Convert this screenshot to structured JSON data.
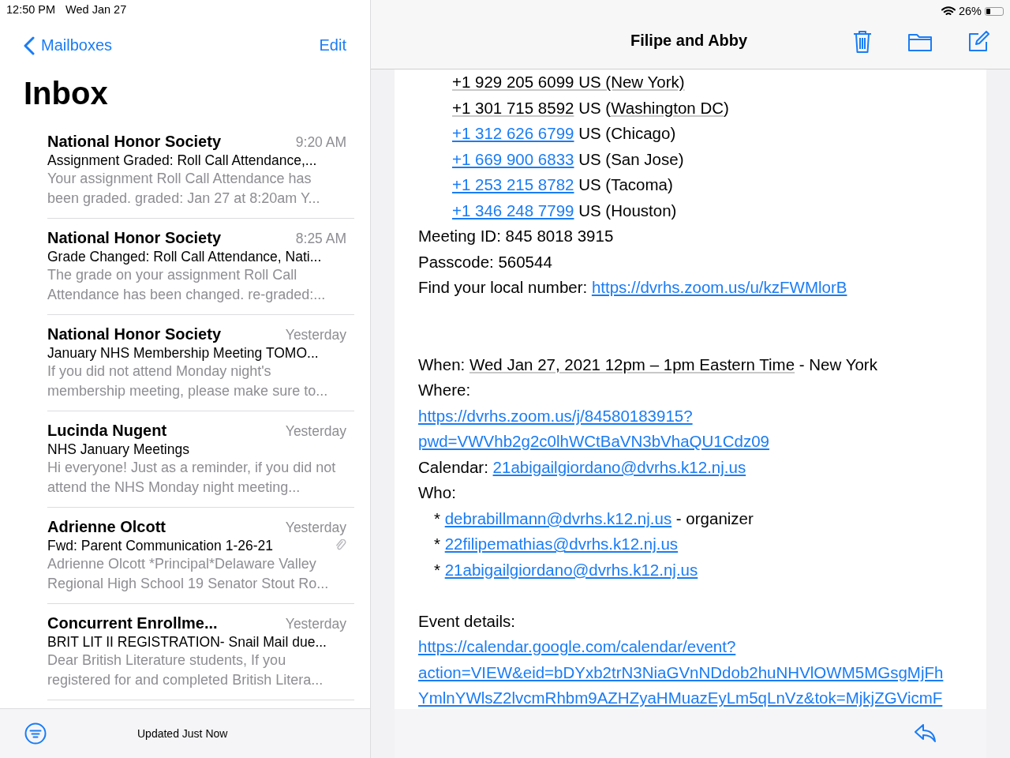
{
  "status_bar": {
    "time": "12:50 PM",
    "date": "Wed Jan 27",
    "battery_text": "26%"
  },
  "sidebar": {
    "back_label": "Mailboxes",
    "edit_label": "Edit",
    "title": "Inbox",
    "messages": [
      {
        "sender": "National Honor Society",
        "time": "9:20 AM",
        "subject": "Assignment Graded: Roll Call Attendance,...",
        "preview": "Your assignment Roll Call Attendance has been graded. graded: Jan 27 at 8:20am Y...",
        "attachment": false
      },
      {
        "sender": "National Honor Society",
        "time": "8:25 AM",
        "subject": "Grade Changed: Roll Call Attendance, Nati...",
        "preview": "The grade on your assignment Roll Call Attendance has been changed. re-graded:...",
        "attachment": false
      },
      {
        "sender": "National Honor Society",
        "time": "Yesterday",
        "subject": "January NHS Membership Meeting TOMO...",
        "preview": "If you did not attend Monday night's membership meeting, please make sure to...",
        "attachment": false
      },
      {
        "sender": "Lucinda Nugent",
        "time": "Yesterday",
        "subject": "NHS January Meetings",
        "preview": "Hi everyone! Just as a reminder, if you did not attend the NHS Monday night meeting...",
        "attachment": false
      },
      {
        "sender": "Adrienne Olcott",
        "time": "Yesterday",
        "subject": "Fwd: Parent Communication 1-26-21",
        "preview": "Adrienne Olcott *Principal*Delaware Valley Regional High School 19 Senator Stout Ro...",
        "attachment": true
      },
      {
        "sender": "Concurrent Enrollme...",
        "time": "Yesterday",
        "subject": "BRIT LIT II REGISTRATION- Snail Mail due...",
        "preview": "Dear British Literature students, If you registered for and completed British Litera...",
        "attachment": false
      }
    ],
    "footer_status": "Updated Just Now"
  },
  "message": {
    "title": "Filipe and Abby",
    "lines": [
      {
        "kind": "indented",
        "segments": [
          {
            "kind": "detected",
            "text": "+1 929 205 6099 US (New York)"
          }
        ]
      },
      {
        "kind": "indented",
        "segments": [
          {
            "kind": "detected",
            "text": "+1 301 715 8592"
          },
          {
            "kind": "plain",
            "text": " US ("
          },
          {
            "kind": "detected",
            "text": "Washington DC"
          },
          {
            "kind": "plain",
            "text": ")"
          }
        ]
      },
      {
        "kind": "indented",
        "segments": [
          {
            "kind": "link",
            "text": "+1 312 626 6799"
          },
          {
            "kind": "plain",
            "text": " US (Chicago)"
          }
        ]
      },
      {
        "kind": "indented",
        "segments": [
          {
            "kind": "link",
            "text": "+1 669 900 6833"
          },
          {
            "kind": "plain",
            "text": " US (San Jose)"
          }
        ]
      },
      {
        "kind": "indented",
        "segments": [
          {
            "kind": "link",
            "text": "+1 253 215 8782"
          },
          {
            "kind": "plain",
            "text": " US (Tacoma)"
          }
        ]
      },
      {
        "kind": "indented",
        "segments": [
          {
            "kind": "link",
            "text": "+1 346 248 7799"
          },
          {
            "kind": "plain",
            "text": " US (Houston)"
          }
        ]
      },
      {
        "kind": "normal",
        "segments": [
          {
            "kind": "plain",
            "text": "Meeting ID: 845 8018 3915"
          }
        ]
      },
      {
        "kind": "normal",
        "segments": [
          {
            "kind": "plain",
            "text": "Passcode: 560544"
          }
        ]
      },
      {
        "kind": "normal",
        "segments": [
          {
            "kind": "plain",
            "text": "Find your local number: "
          },
          {
            "kind": "link",
            "text": "https://dvrhs.zoom.us/u/kzFWMlorB"
          }
        ]
      },
      {
        "kind": "blank"
      },
      {
        "kind": "blank"
      },
      {
        "kind": "normal",
        "segments": [
          {
            "kind": "plain",
            "text": "When: "
          },
          {
            "kind": "detected",
            "text": "Wed Jan 27, 2021 12pm – 1pm Eastern Time"
          },
          {
            "kind": "plain",
            "text": " - New York"
          }
        ]
      },
      {
        "kind": "normal",
        "segments": [
          {
            "kind": "plain",
            "text": "Where:"
          }
        ]
      },
      {
        "kind": "normal",
        "segments": [
          {
            "kind": "link",
            "text": "https://dvrhs.zoom.us/j/84580183915?"
          }
        ]
      },
      {
        "kind": "normal",
        "segments": [
          {
            "kind": "link",
            "text": "pwd=VWVhb2g2c0lhWCtBaVN3bVhaQU1Cdz09"
          }
        ]
      },
      {
        "kind": "normal",
        "segments": [
          {
            "kind": "plain",
            "text": "Calendar: "
          },
          {
            "kind": "link",
            "text": "21abigailgiordano@dvrhs.k12.nj.us"
          }
        ]
      },
      {
        "kind": "normal",
        "segments": [
          {
            "kind": "plain",
            "text": "Who:"
          }
        ]
      },
      {
        "kind": "bullet",
        "segments": [
          {
            "kind": "plain",
            "text": "* "
          },
          {
            "kind": "link",
            "text": "debrabillmann@dvrhs.k12.nj.us"
          },
          {
            "kind": "plain",
            "text": " - organizer"
          }
        ]
      },
      {
        "kind": "bullet",
        "segments": [
          {
            "kind": "plain",
            "text": "* "
          },
          {
            "kind": "link",
            "text": "22filipemathias@dvrhs.k12.nj.us"
          }
        ]
      },
      {
        "kind": "bullet",
        "segments": [
          {
            "kind": "plain",
            "text": "* "
          },
          {
            "kind": "link",
            "text": "21abigailgiordano@dvrhs.k12.nj.us"
          }
        ]
      },
      {
        "kind": "blank"
      },
      {
        "kind": "normal",
        "segments": [
          {
            "kind": "plain",
            "text": "Event details:"
          }
        ]
      },
      {
        "kind": "normal",
        "segments": [
          {
            "kind": "link",
            "text": "https://calendar.google.com/calendar/event?"
          }
        ]
      },
      {
        "kind": "normal",
        "segments": [
          {
            "kind": "link",
            "text": "action=VIEW&eid=bDYxb2trN3NiaGVnNDdob2huNHVlOWM5MGsgMjFh"
          }
        ]
      },
      {
        "kind": "normal",
        "segments": [
          {
            "kind": "link",
            "text": "YmlnYWlsZ2lvcmRhbm9AZHZyaHMuazEyLm5qLnVz&tok=MjkjZGVicmF"
          }
        ]
      }
    ]
  }
}
